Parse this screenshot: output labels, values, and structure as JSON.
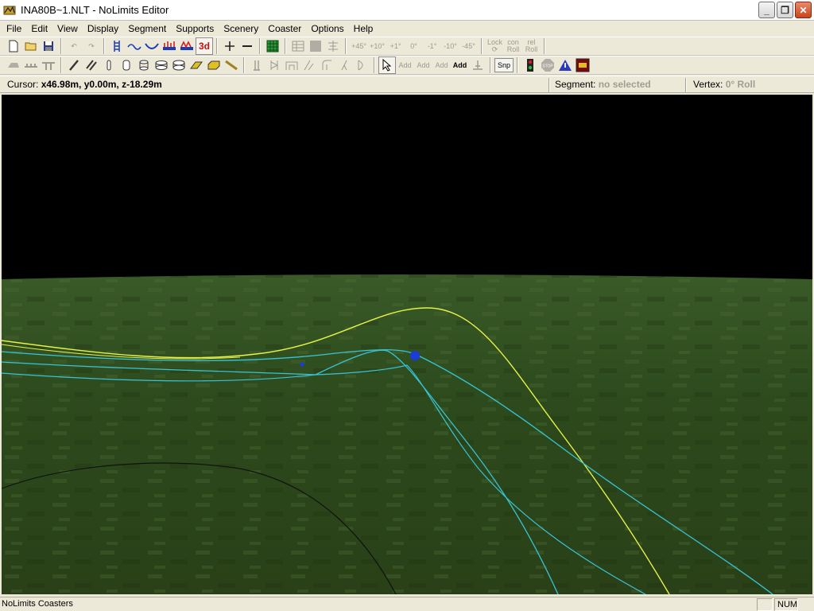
{
  "window": {
    "title": "INA80B~1.NLT - NoLimits Editor",
    "controls": {
      "minimize": "_",
      "restore": "❐",
      "close": "✕"
    }
  },
  "menu": [
    "File",
    "Edit",
    "View",
    "Display",
    "Segment",
    "Supports",
    "Scenery",
    "Coaster",
    "Options",
    "Help"
  ],
  "toolbar1": {
    "view_3d_label": "3d",
    "roll_buttons": [
      "+45°",
      "+10°",
      "+1°",
      "0°",
      "-1°",
      "-10°",
      "-45°"
    ],
    "lock_roll_label": "Lock ⟳",
    "con_roll_label": "con Roll",
    "rel_roll_label": "rel Roll"
  },
  "toolbar2": {
    "add_labels": [
      "Add",
      "Add",
      "Add",
      "Add"
    ],
    "snp_label": "Snp",
    "stop_label": "STOP"
  },
  "infobar": {
    "cursor_label": "Cursor: ",
    "cursor_value": "x46.98m, y0.00m, z-18.29m",
    "segment_label": "Segment: ",
    "segment_value": "no selected",
    "vertex_label": "Vertex: ",
    "vertex_value": "0° Roll"
  },
  "statusbar": {
    "text": "NoLimits Coasters",
    "num": "NUM"
  },
  "colors": {
    "track_selected": "#e6f24a",
    "track": "#38c4d6",
    "vertex": "#1a3cd8",
    "ground": "#2f4a1e",
    "sky": "#000000"
  }
}
